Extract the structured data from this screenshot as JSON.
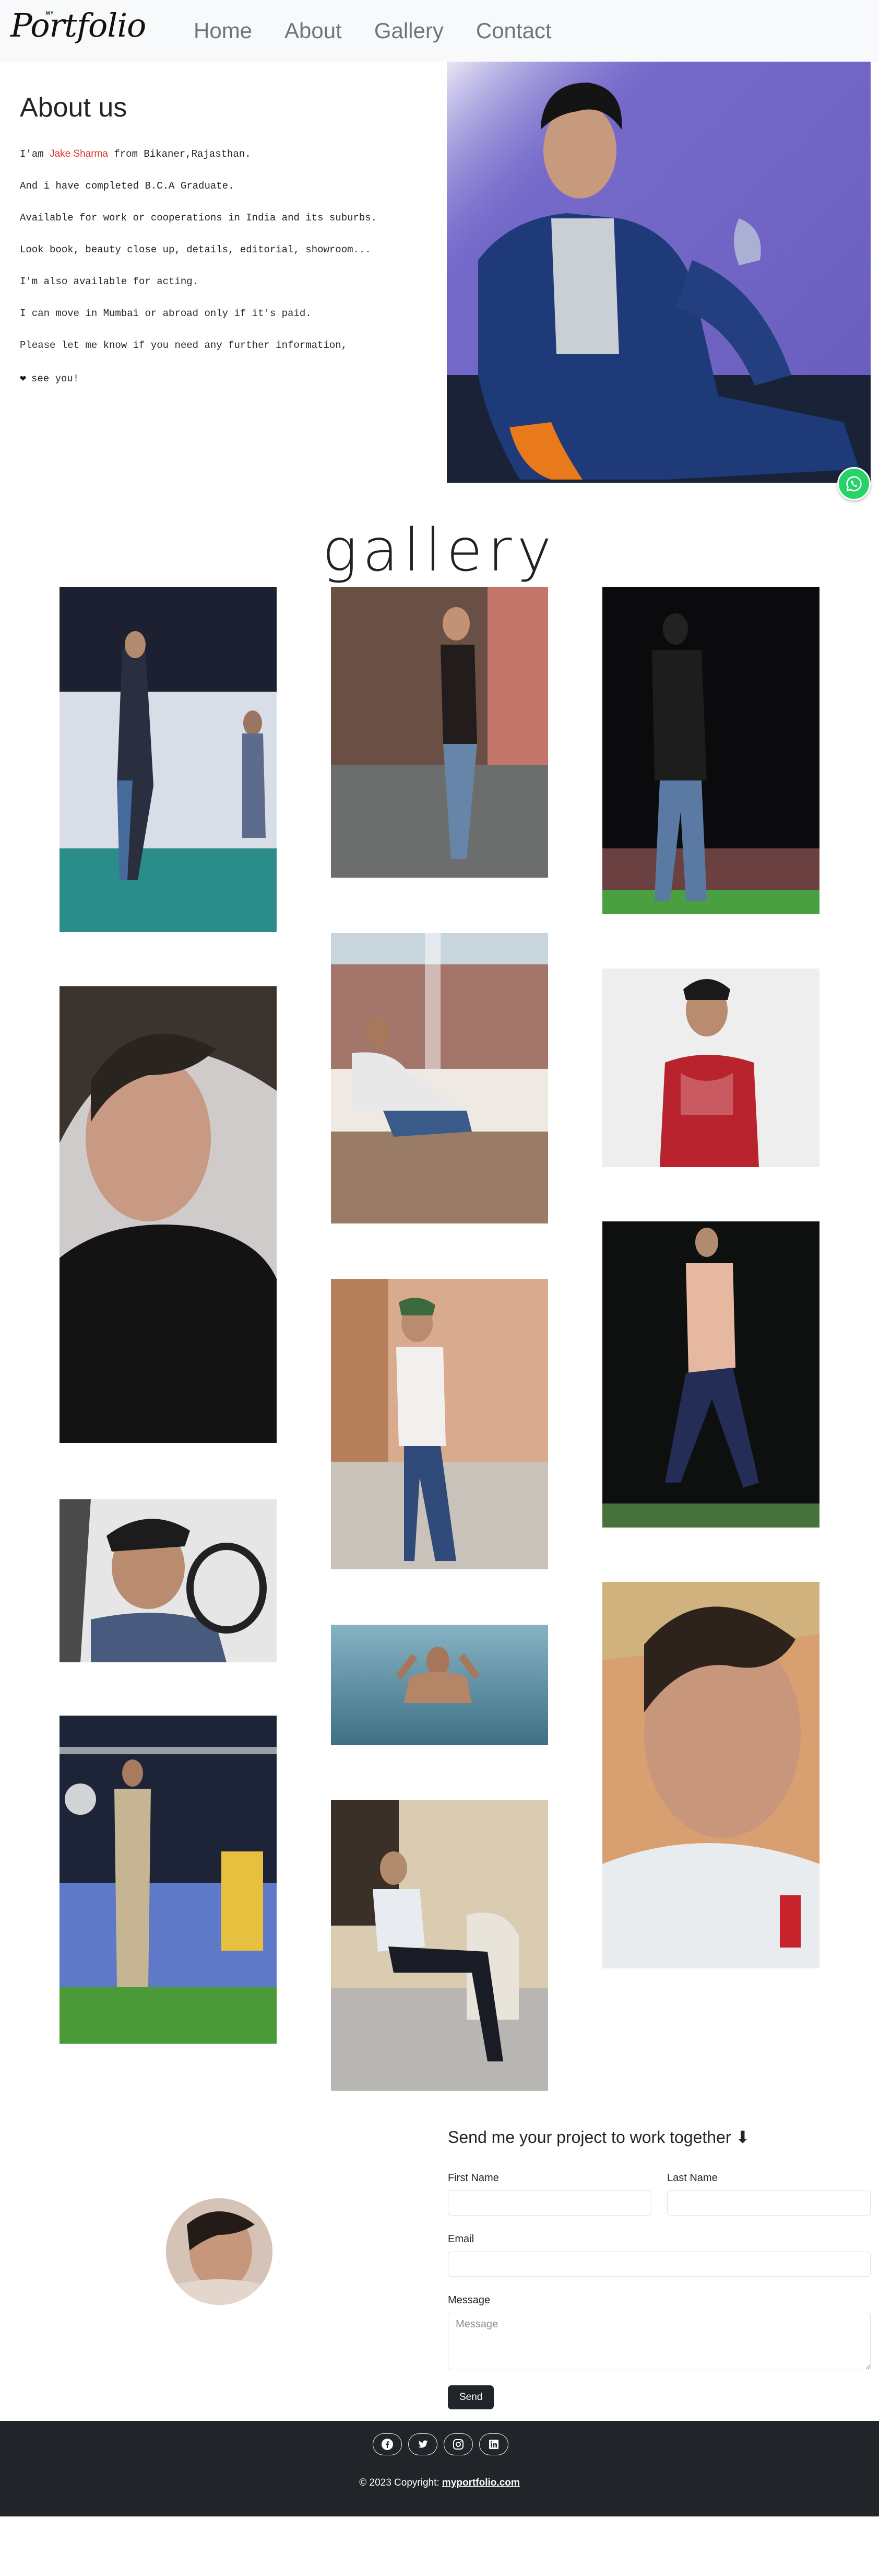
{
  "brand": {
    "small": "MY",
    "main": "Portfolio"
  },
  "nav": {
    "items": [
      {
        "label": "Home"
      },
      {
        "label": "About"
      },
      {
        "label": "Gallery"
      },
      {
        "label": "Contact"
      }
    ]
  },
  "about": {
    "title": "About us",
    "line1_pre": "I'am ",
    "line1_name": "Jake Sharma",
    "line1_post": " from Bikaner,Rajasthan.",
    "line2": "And i have completed B.C.A Graduate.",
    "line3": "Available for work or cooperations in India and its suburbs.",
    "line4": "Look book, beauty close up, details, editorial, showroom...",
    "line5": "I'm also available for acting.",
    "line6": "I can move in Mumbai or abroad only if it's paid.",
    "line7": "Please let me know if you need any further information,",
    "line8": "see you!"
  },
  "gallery": {
    "title": "gallery"
  },
  "contact": {
    "title": "Send me your project to work together ⬇",
    "first_name_label": "First Name",
    "last_name_label": "Last Name",
    "email_label": "Email",
    "message_label": "Message",
    "message_placeholder": "Message",
    "send_label": "Send"
  },
  "footer": {
    "copyright_prefix": "© 2023 Copyright: ",
    "copyright_link": "myportfolio.com",
    "social_icons": [
      "facebook-icon",
      "twitter-icon",
      "instagram-icon",
      "linkedin-icon"
    ]
  },
  "colors": {
    "accent_name": "#e0342c",
    "footer_bg": "#212529",
    "whatsapp": "#25d366"
  }
}
